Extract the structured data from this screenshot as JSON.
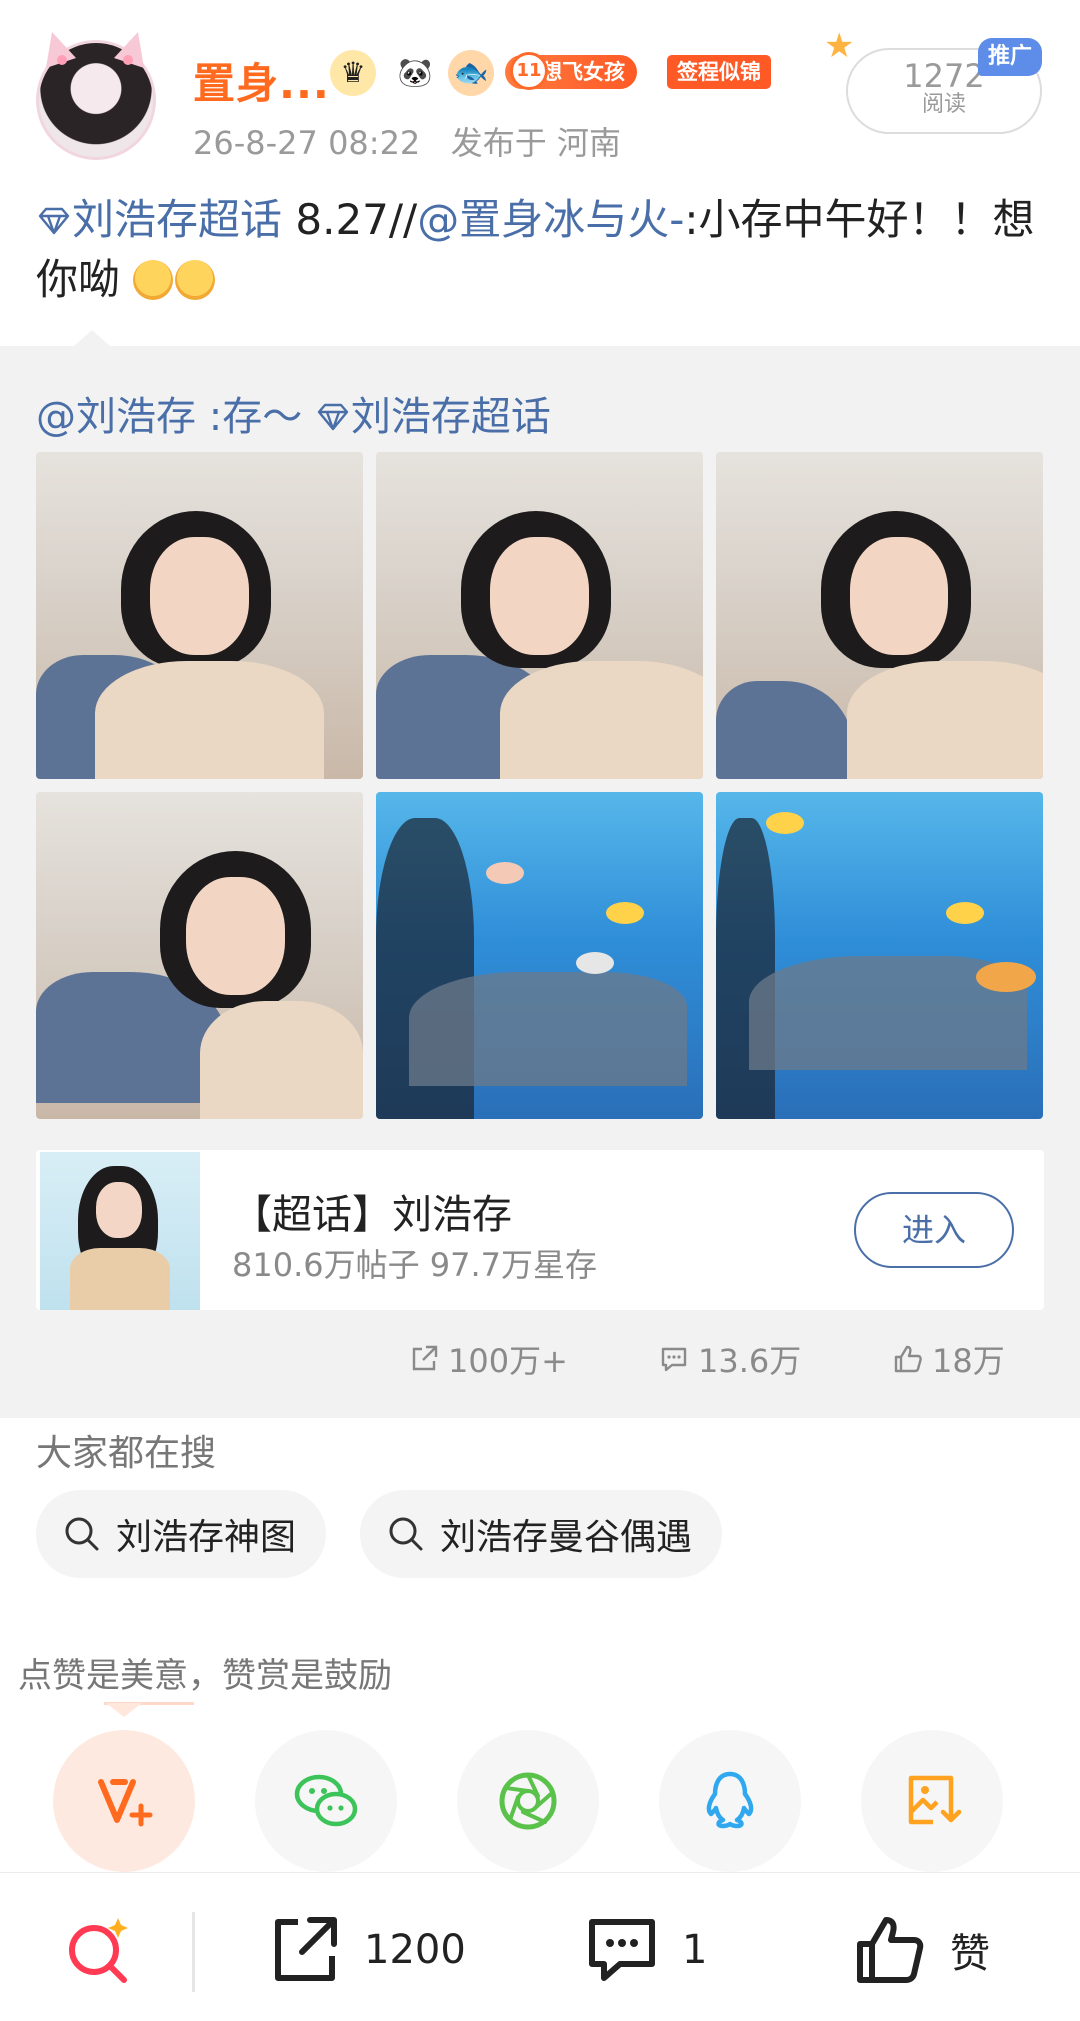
{
  "header": {
    "username": "置身...",
    "badge_level": "11",
    "badge_title": "想飞女孩",
    "badge_sign": "签程似锦",
    "post_time": "26-8-27 08:22",
    "location": "发布于 河南",
    "read_count": "1272",
    "read_label": "阅读",
    "promo_tag": "推广"
  },
  "post": {
    "topic_link": "刘浩存超话",
    "text_date": " 8.27//",
    "mention": "@置身冰与火-",
    "text_body": ":小存中午好！！想你呦"
  },
  "repost": {
    "mention": "@刘浩存",
    "text": " :存～ ",
    "topic_link": "刘浩存超话",
    "topic_card": {
      "title": "【超话】刘浩存",
      "stats": "810.6万帖子 97.7万星存",
      "enter_label": "进入"
    },
    "stats": {
      "reposts": "100万+",
      "comments": "13.6万",
      "likes": "18万"
    }
  },
  "search": {
    "title": "大家都在搜",
    "chips": [
      "刘浩存神图",
      "刘浩存曼谷偶遇"
    ]
  },
  "reward": {
    "text": "点赞是美意，赞赏是鼓励"
  },
  "bottom_bar": {
    "share_count": "1200",
    "comment_count": "1",
    "like_label": "赞"
  },
  "colors": {
    "accent_orange": "#ff6a1f",
    "link_blue": "#4a6fa8",
    "wechat_green": "#3cc45a",
    "qq_blue": "#2fa8f0",
    "gallery_orange": "#ffa21f"
  }
}
